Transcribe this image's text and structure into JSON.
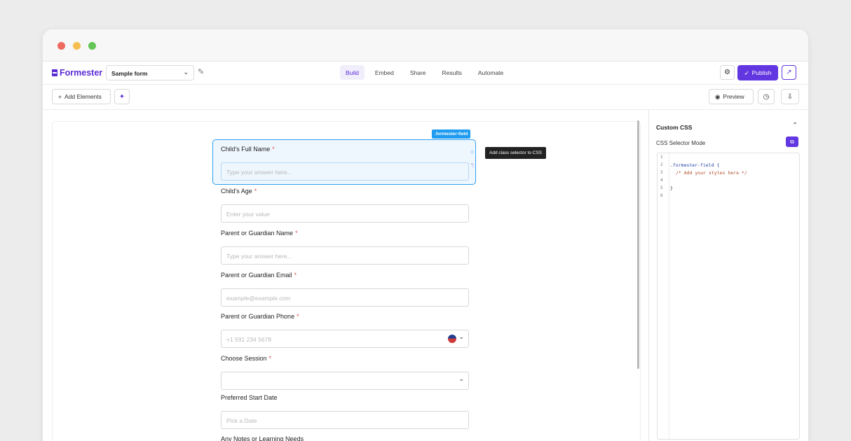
{
  "app": {
    "logo": "Formester",
    "form_name": "Sample form"
  },
  "tabs": [
    "Build",
    "Embed",
    "Share",
    "Results",
    "Automate"
  ],
  "header": {
    "publish": "Publish"
  },
  "toolbar": {
    "add_elements": "Add Elements",
    "preview": "Preview"
  },
  "canvas": {
    "selected_tag": ".formester-field",
    "tooltip": "Add class selector to CSS"
  },
  "fields": [
    {
      "label": "Child's Full Name",
      "required": "*",
      "placeholder": "Type your answer here..."
    },
    {
      "label": "Child's Age",
      "required": "*",
      "placeholder": "Enter your value"
    },
    {
      "label": "Parent or Guardian Name",
      "required": "*",
      "placeholder": "Type your answer here..."
    },
    {
      "label": "Parent or Guardian Email",
      "required": "*",
      "placeholder": "example@example.com"
    },
    {
      "label": "Parent or Guardian Phone",
      "required": "*",
      "placeholder": "+1 591 234 5678"
    },
    {
      "label": "Choose Session",
      "required": "*",
      "placeholder": ""
    },
    {
      "label": "Preferred Start Date",
      "required": "",
      "placeholder": "Pick a Date"
    },
    {
      "label": "Any Notes or Learning Needs",
      "required": "",
      "placeholder": ""
    }
  ],
  "panel": {
    "title": "Custom CSS",
    "mode_label": "CSS Selector Mode"
  },
  "code": {
    "lines": [
      "1",
      "2",
      "3",
      "4",
      "5",
      "6"
    ],
    "line2": ".formester-field {",
    "line3": "/* Add your styles here */",
    "line5": "}"
  },
  "colors": {
    "accent": "#6236e0",
    "selection": "#2ea0f0",
    "traffic_red": "#ee6a5f",
    "traffic_yellow": "#f5be4f",
    "traffic_green": "#62c554"
  }
}
